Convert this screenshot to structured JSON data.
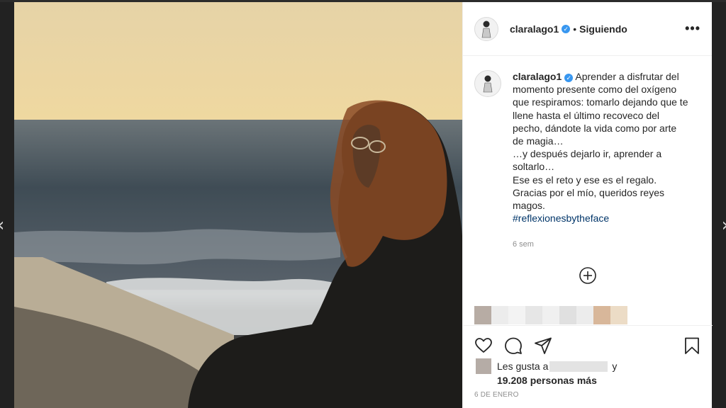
{
  "post": {
    "username": "claralago1",
    "follow_status": "Siguiendo",
    "caption_lines": [
      "Aprender a disfrutar del momento presente como del oxígeno que respiramos: tomarlo dejando que te llene hasta el último recoveco del pecho, dándote la vida como por arte de magia…",
      "…y después dejarlo ir, aprender a soltarlo…",
      "Ese es el reto y ese es el regalo.",
      "Gracias por el mío, queridos reyes magos."
    ],
    "hashtag": "#reflexionesbytheface",
    "time_ago": "6 sem",
    "likes_prefix": "Les gusta a",
    "likes_and": "y",
    "likes_count": "19.208 personas más",
    "date": "6 DE ENERO"
  },
  "icons": {
    "verified": "verified-badge-icon",
    "more": "more-options-icon",
    "load_more": "plus-circle-icon",
    "like": "heart-icon",
    "comment": "comment-icon",
    "share": "paper-plane-icon",
    "save": "bookmark-icon",
    "prev": "chevron-left-icon",
    "next": "chevron-right-icon"
  },
  "colors": {
    "hashtag": "#003569",
    "verified": "#3897f0",
    "secondary_text": "#8e8e8e"
  }
}
